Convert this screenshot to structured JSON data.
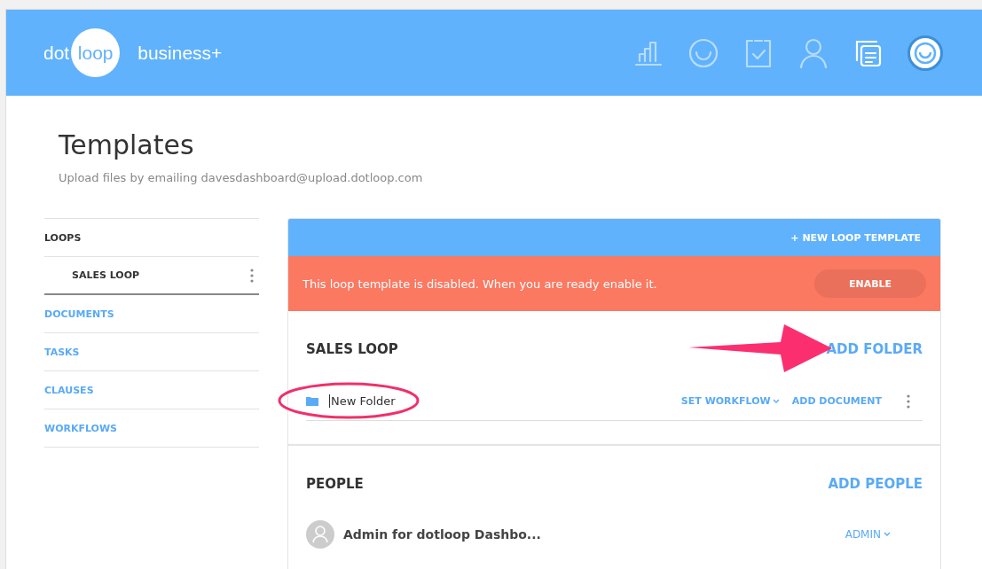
{
  "header": {
    "logo_left": "dot",
    "logo_circle": "loop",
    "product": "business+",
    "nav_icons": [
      {
        "kind": "chart",
        "selected": false
      },
      {
        "kind": "smiley",
        "selected": false
      },
      {
        "kind": "clipboard",
        "selected": false
      },
      {
        "kind": "person",
        "selected": false
      },
      {
        "kind": "documents",
        "selected": true
      }
    ]
  },
  "page": {
    "title": "Templates",
    "subtitle": "Upload files by emailing davesdashboard@upload.dotloop.com"
  },
  "sidebar": {
    "items": [
      {
        "label": "LOOPS",
        "kind": "heading",
        "selected": false
      },
      {
        "label": "SALES LOOP",
        "kind": "loop",
        "selected": true
      },
      {
        "label": "DOCUMENTS",
        "kind": "link",
        "selected": false
      },
      {
        "label": "TASKS",
        "kind": "link",
        "selected": false
      },
      {
        "label": "CLAUSES",
        "kind": "link",
        "selected": false
      },
      {
        "label": "WORKFLOWS",
        "kind": "link",
        "selected": false
      }
    ]
  },
  "card": {
    "new_button": "+ NEW LOOP TEMPLATE",
    "banner": {
      "message": "This loop template is disabled. When you are ready enable it.",
      "button": "ENABLE"
    },
    "loop": {
      "title": "SALES LOOP",
      "action": "ADD FOLDER",
      "folders": [
        {
          "name": "New Folder",
          "workflow": "SET WORKFLOW",
          "add": "ADD DOCUMENT"
        }
      ]
    },
    "people": {
      "title": "PEOPLE",
      "action": "ADD PEOPLE",
      "members": [
        {
          "name": "Admin for dotloop Dashbo...",
          "role": "ADMIN"
        }
      ]
    }
  }
}
